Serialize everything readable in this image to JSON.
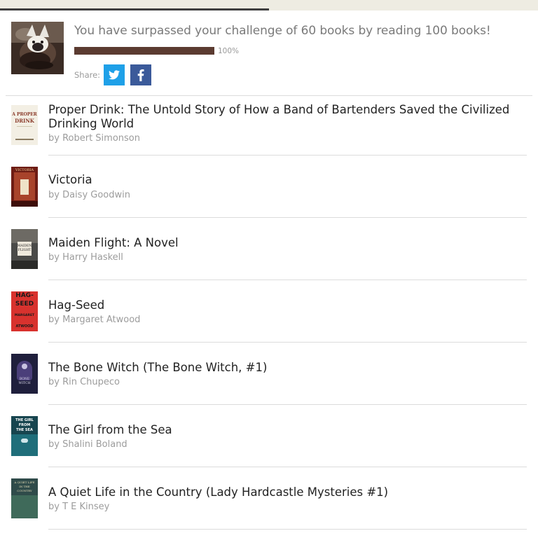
{
  "challenge": {
    "message": "You have surpassed your challenge of 60 books by reading 100 books!",
    "progress": 1.0,
    "progress_label": "100%",
    "share_label": "Share:",
    "twitter_icon": "twitter-icon",
    "facebook_icon": "facebook-icon",
    "twitter_color": "#1ea0e8",
    "facebook_color": "#3b5a9a",
    "bar_color": "#5b3b31"
  },
  "books": [
    {
      "title": "Proper Drink: The Untold Story of How a Band of Bartenders Saved the Civilized Drinking World",
      "author": "by Robert Simonson",
      "cover_text": [
        "A PROPER",
        "DRINK"
      ]
    },
    {
      "title": "Victoria",
      "author": "by Daisy Goodwin",
      "cover_text": [
        "VICTORIA"
      ]
    },
    {
      "title": "Maiden Flight: A Novel",
      "author": "by Harry Haskell",
      "cover_text": [
        "MAIDEN",
        "FLIGHT"
      ]
    },
    {
      "title": "Hag-Seed",
      "author": "by Margaret Atwood",
      "cover_text": [
        "HAG-",
        "SEED",
        "MARGARET",
        "ATWOOD"
      ]
    },
    {
      "title": "The Bone Witch (The Bone Witch, #1)",
      "author": "by Rin Chupeco",
      "cover_text": [
        "BONE",
        "WITCH"
      ]
    },
    {
      "title": "The Girl from the Sea",
      "author": "by Shalini Boland",
      "cover_text": [
        "THE GIRL",
        "FROM",
        "THE SEA"
      ]
    },
    {
      "title": "A Quiet Life in the Country (Lady Hardcastle Mysteries #1)",
      "author": "by T E Kinsey",
      "cover_text": [
        "A QUIET LIFE",
        "IN THE",
        "COUNTRY"
      ]
    }
  ]
}
